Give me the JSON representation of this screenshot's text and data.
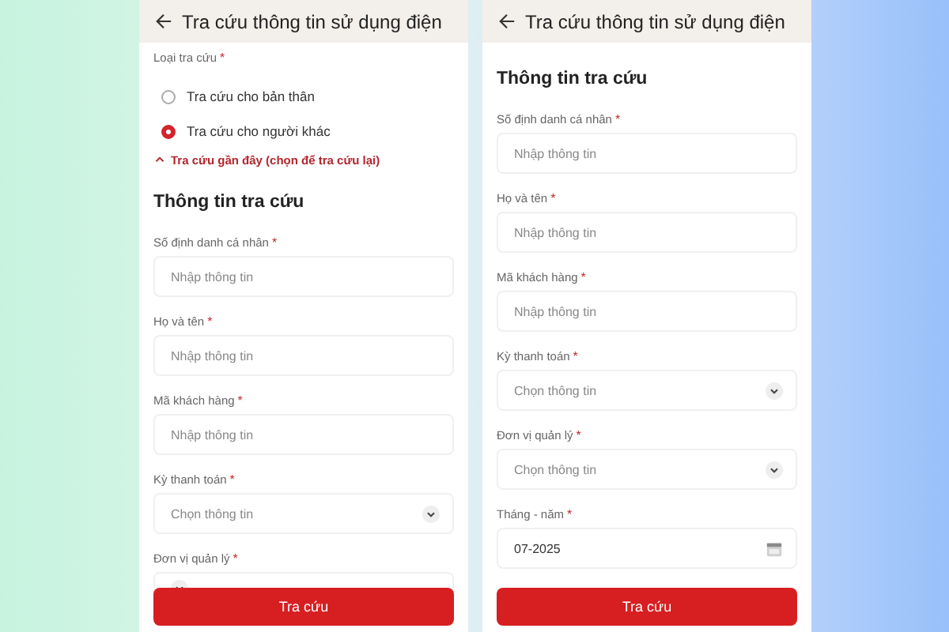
{
  "screens": [
    {
      "title": "Tra cứu thông tin sử dụng điện",
      "items": [
        {
          "kind": "label",
          "text": "Loại tra cứu",
          "mark": "*"
        },
        {
          "kind": "radio",
          "label": "Tra cứu cho bản thân",
          "selected": false
        },
        {
          "kind": "radio",
          "label": "Tra cứu cho người khác",
          "selected": true
        },
        {
          "kind": "recent",
          "text": "Tra cứu gần đây (chọn để tra cứu lại)",
          "expanded": true
        },
        {
          "kind": "section",
          "text": "Thông tin tra cứu"
        },
        {
          "kind": "input",
          "label": "Số định danh cá nhân",
          "mark": "*",
          "placeholder": "Nhập thông tin"
        },
        {
          "kind": "input",
          "label": "Họ và tên",
          "mark": "*",
          "placeholder": "Nhập thông tin"
        },
        {
          "kind": "input",
          "label": "Mã khách hàng",
          "mark": "*",
          "placeholder": "Nhập thông tin"
        },
        {
          "kind": "select",
          "label": "Kỳ thanh toán",
          "mark": "*",
          "placeholder": "Chọn thông tin"
        },
        {
          "kind": "select",
          "label": "Đơn vị quản lý",
          "mark": "*"
        }
      ],
      "submit": "Tra cứu"
    },
    {
      "title": "Tra cứu thông tin sử dụng điện",
      "items": [
        {
          "kind": "section",
          "text": "Thông tin tra cứu"
        },
        {
          "kind": "input",
          "label": "Số định danh cá nhân",
          "mark": "*",
          "placeholder": "Nhập thông tin"
        },
        {
          "kind": "input",
          "label": "Họ và tên",
          "mark": "*",
          "placeholder": "Nhập thông tin"
        },
        {
          "kind": "input",
          "label": "Mã khách hàng",
          "mark": "*",
          "placeholder": "Nhập thông tin"
        },
        {
          "kind": "select",
          "label": "Kỳ thanh toán",
          "mark": "*",
          "placeholder": "Chọn thông tin"
        },
        {
          "kind": "select",
          "label": "Đơn vị quản lý",
          "mark": "*",
          "placeholder": "Chọn thông tin"
        },
        {
          "kind": "date",
          "label": "Tháng - năm",
          "mark": "*",
          "value": "07-2025"
        }
      ],
      "submit": "Tra cứu"
    }
  ]
}
